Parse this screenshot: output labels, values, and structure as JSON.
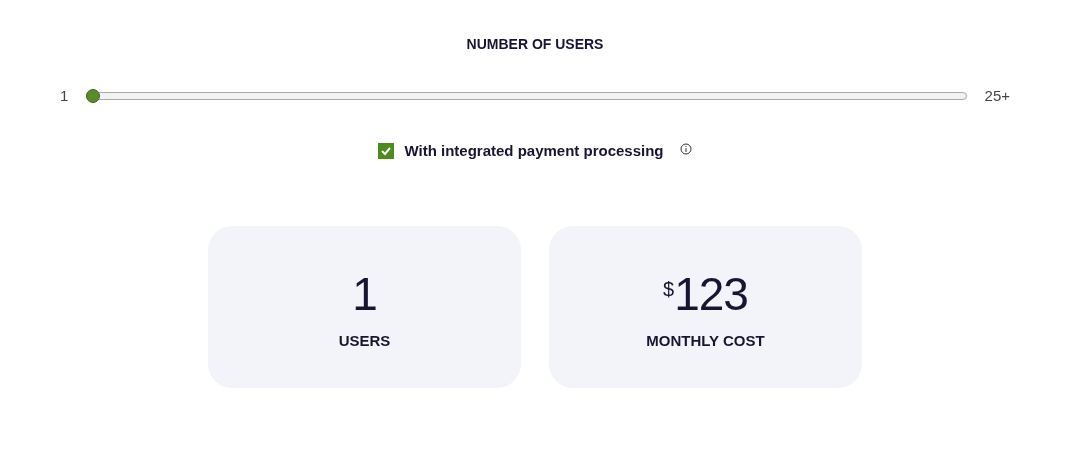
{
  "slider": {
    "title": "NUMBER OF USERS",
    "min_label": "1",
    "max_label": "25+",
    "level": 0
  },
  "option": {
    "label": "With integrated payment processing",
    "checked": true
  },
  "cards": [
    {
      "value": "1",
      "label": "USERS"
    },
    {
      "prefix": "$",
      "value": "123",
      "label": "MONTHLY COST"
    }
  ]
}
